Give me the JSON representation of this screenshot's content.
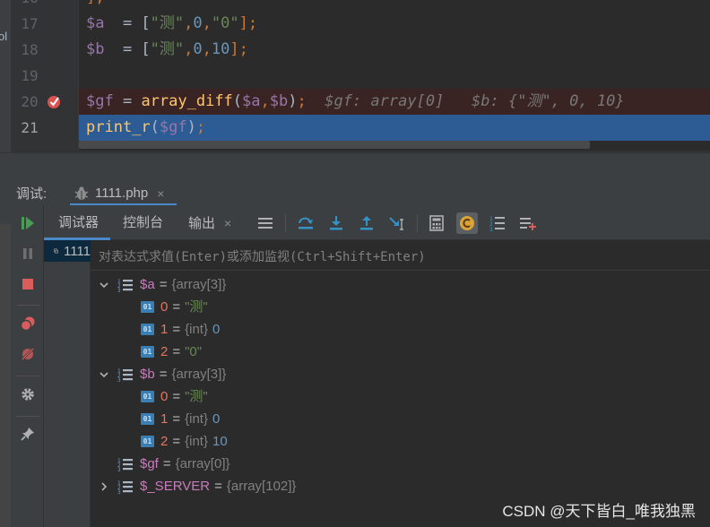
{
  "editor": {
    "left_stub": "ol",
    "lines": [
      {
        "num": "17",
        "code": "$a_line"
      },
      {
        "num": "18",
        "code": "$b_line"
      },
      {
        "num": "19",
        "code": ""
      },
      {
        "num": "20",
        "code": "gf_line"
      },
      {
        "num": "21",
        "code": "print_line"
      }
    ],
    "top_partial": {
      "num": "16",
      "text": "];"
    },
    "line17": {
      "var": "$a",
      "op": "  = [",
      "s1": "\"测\"",
      "c1": ",",
      "n1": "0",
      "c2": ",",
      "s2": "\"0\"",
      "end": "];"
    },
    "line18": {
      "var": "$b",
      "op": "  = [",
      "s1": "\"测\"",
      "c1": ",",
      "n1": "0",
      "c2": ",",
      "n2": "10",
      "end": "];"
    },
    "line20": {
      "var": "$gf",
      "op": " = ",
      "fn": "array_diff",
      "p1": "(",
      "a1": "$a",
      "cm": ",",
      "a2": "$b",
      "p2": ")",
      "semi": ";",
      "hint1": "$gf: array[0]",
      "hint2": "$b: {\"测\", 0, 10}"
    },
    "line21": {
      "fn": "print_r",
      "p1": "(",
      "a1": "$gf",
      "p2": ")",
      "semi": ";"
    }
  },
  "debug": {
    "label": "调试:",
    "file_tab": "1111.php",
    "close_glyph": "×"
  },
  "toolbar": {
    "tabs": [
      {
        "label": "调试器",
        "active": true
      },
      {
        "label": "控制台",
        "active": false
      },
      {
        "label": "输出",
        "active": false
      }
    ],
    "output_close": "×"
  },
  "frames": {
    "item": "1111"
  },
  "variables": {
    "eval_placeholder": "对表达式求值(Enter)或添加监视(Ctrl+Shift+Enter)",
    "rows": [
      {
        "name": "$a",
        "type": "{array[3]}"
      },
      {
        "name": "0",
        "value": "\"测\""
      },
      {
        "name": "1",
        "type": "{int}",
        "value": "0"
      },
      {
        "name": "2",
        "value": "\"0\""
      },
      {
        "name": "$b",
        "type": "{array[3]}"
      },
      {
        "name": "0",
        "value": "\"测\""
      },
      {
        "name": "1",
        "type": "{int}",
        "value": "0"
      },
      {
        "name": "2",
        "type": "{int}",
        "value": "10"
      },
      {
        "name": "$gf",
        "type": "{array[0]}"
      },
      {
        "name": "$_SERVER",
        "type": "{array[102]}"
      }
    ],
    "eq": "="
  },
  "watermark": "CSDN @天下皆白_唯我独黑",
  "colors": {
    "exec_line": "#2d5c94",
    "breakpoint_line": "#3a2323",
    "accent": "#4a88c7",
    "variable": "#c77dbb",
    "index": "#e5755f",
    "string": "#6a8759",
    "number": "#6897bb"
  }
}
